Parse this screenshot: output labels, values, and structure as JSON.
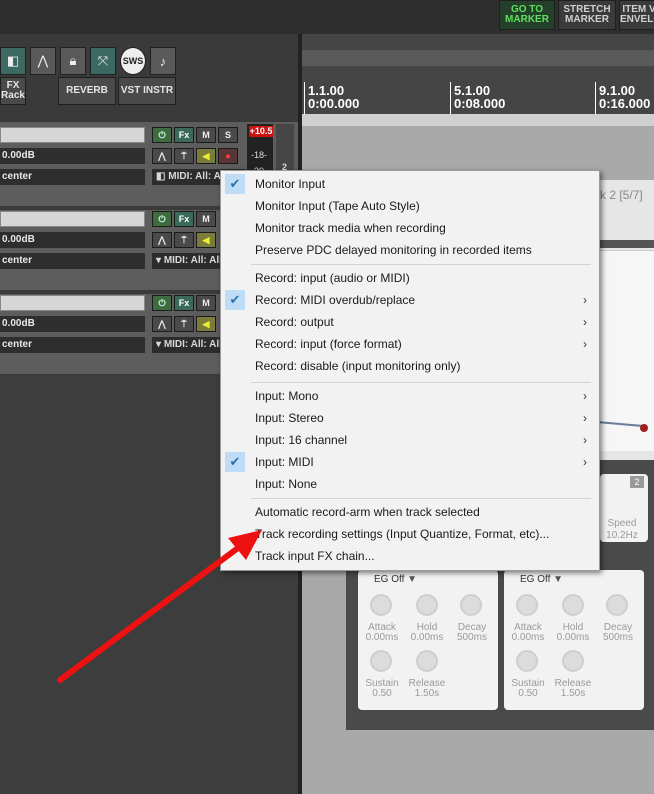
{
  "toolbar": {
    "go_to_marker": "GO TO MARKER",
    "stretch_marker": "STRETCH MARKER",
    "item_envelope": "ITEM V ENVELO",
    "fx_rack": "FX Rack",
    "reverb": "REVERB",
    "vst_instr": "VST INSTR",
    "sws": "SWS"
  },
  "ruler": [
    {
      "bar": "1.1.00",
      "time": "0:00.000"
    },
    {
      "bar": "5.1.00",
      "time": "0:08.000"
    },
    {
      "bar": "9.1.00",
      "time": "0:16.000"
    }
  ],
  "tracks": [
    {
      "volume": "0.00dB",
      "pan": "center",
      "midi": "MIDI: All: A",
      "fx": "Fx",
      "mute": "M",
      "solo": "S"
    },
    {
      "volume": "0.00dB",
      "pan": "center",
      "midi": "MIDI: All: All",
      "fx": "Fx",
      "mute": "M"
    },
    {
      "volume": "0.00dB",
      "pan": "center",
      "midi": "MIDI: All: All",
      "fx": "Fx",
      "mute": "M"
    }
  ],
  "meter": {
    "peak": "+10.5",
    "scale_a": "-18-",
    "scale_b": "-30-",
    "track_num": "2"
  },
  "window_title_fragment": "k 2 [5/7]",
  "plugin": {
    "badge": "2",
    "speed_label": "Speed",
    "speed_value": "10.2Hz",
    "panels": [
      {
        "eg": "EG Off",
        "attack": "Attack",
        "attack_v": "0.00ms",
        "hold": "Hold",
        "hold_v": "0.00ms",
        "decay": "Decay",
        "decay_v": "500ms",
        "sustain": "Sustain",
        "sustain_v": "0.50",
        "release": "Release",
        "release_v": "1.50s"
      },
      {
        "eg": "EG Off",
        "attack": "Attack",
        "attack_v": "0.00ms",
        "hold": "Hold",
        "hold_v": "0.00ms",
        "decay": "Decay",
        "decay_v": "500ms",
        "sustain": "Sustain",
        "sustain_v": "0.50",
        "release": "Release",
        "release_v": "1.50s"
      }
    ]
  },
  "menu": {
    "items": [
      {
        "label": "Monitor Input",
        "checked": true,
        "submenu": false
      },
      {
        "label": "Monitor Input (Tape Auto Style)",
        "checked": false,
        "submenu": false
      },
      {
        "label": "Monitor track media when recording",
        "checked": false,
        "submenu": false
      },
      {
        "label": "Preserve PDC delayed monitoring in recorded items",
        "checked": false,
        "submenu": false
      },
      {
        "label": "Record: input (audio or MIDI)",
        "checked": false,
        "submenu": false
      },
      {
        "label": "Record: MIDI overdub/replace",
        "checked": true,
        "submenu": true
      },
      {
        "label": "Record: output",
        "checked": false,
        "submenu": true
      },
      {
        "label": "Record: input (force format)",
        "checked": false,
        "submenu": true
      },
      {
        "label": "Record: disable (input monitoring only)",
        "checked": false,
        "submenu": false
      },
      {
        "label": "Input: Mono",
        "checked": false,
        "submenu": true
      },
      {
        "label": "Input: Stereo",
        "checked": false,
        "submenu": true
      },
      {
        "label": "Input: 16 channel",
        "checked": false,
        "submenu": true
      },
      {
        "label": "Input: MIDI",
        "checked": true,
        "submenu": true
      },
      {
        "label": "Input: None",
        "checked": false,
        "submenu": false
      },
      {
        "label": "Automatic record-arm when track selected",
        "checked": false,
        "submenu": false
      },
      {
        "label": "Track recording settings (Input Quantize, Format, etc)...",
        "checked": false,
        "submenu": false
      },
      {
        "label": "Track input FX chain...",
        "checked": false,
        "submenu": false
      }
    ],
    "submenu_glyph": "›",
    "check_glyph": "✔"
  },
  "annotation": {
    "arrow_color": "#ee1111"
  }
}
